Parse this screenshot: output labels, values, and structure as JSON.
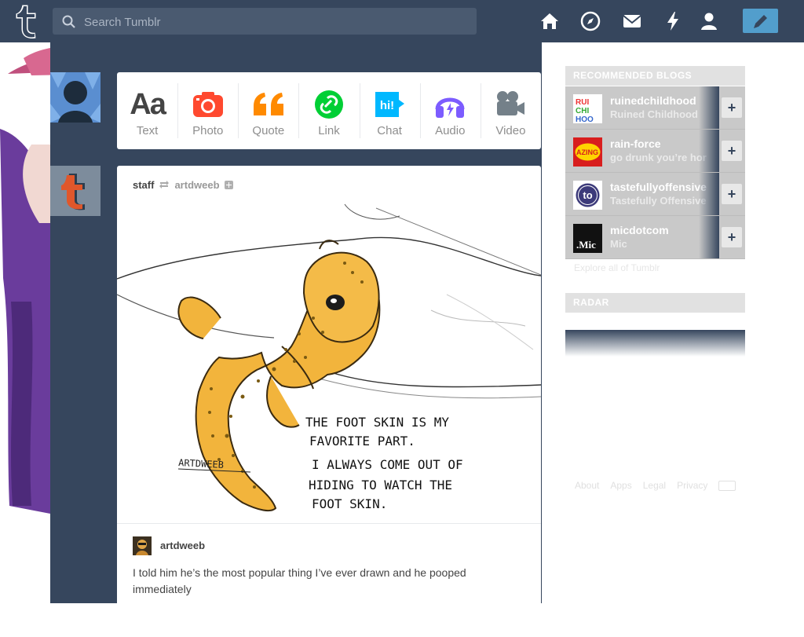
{
  "header": {
    "search_placeholder": "Search Tumblr",
    "nav_icons": [
      "home-icon",
      "compass-icon",
      "mail-icon",
      "lightning-icon",
      "account-icon"
    ],
    "compose_icon": "pencil-icon",
    "colors": {
      "bar": "#36465d",
      "compose": "#529ecc"
    }
  },
  "post_types": [
    {
      "label": "Text",
      "icon": "text-icon",
      "color": "#444444"
    },
    {
      "label": "Photo",
      "icon": "camera-icon",
      "color": "#ff492f"
    },
    {
      "label": "Quote",
      "icon": "quote-icon",
      "color": "#ff8a00"
    },
    {
      "label": "Link",
      "icon": "link-icon",
      "color": "#00cf35"
    },
    {
      "label": "Chat",
      "icon": "chat-icon",
      "color": "#00b8ff"
    },
    {
      "label": "Audio",
      "icon": "headphones-icon",
      "color": "#7c5cff"
    },
    {
      "label": "Video",
      "icon": "video-camera-icon",
      "color": "#748089"
    }
  ],
  "post": {
    "user": "staff",
    "reblogged_from": "artdweeb",
    "artwork_text": {
      "signature": "ARTDWEEB",
      "caption_lines": [
        "THE FOOT SKIN IS MY",
        "FAVORITE PART.",
        "I ALWAYS COME OUT OF",
        "HIDING TO WATCH THE",
        "FOOT SKIN."
      ]
    },
    "reblog": {
      "name": "artdweeb",
      "body": "I told him he’s the most popular thing I’ve ever drawn and he pooped immediately"
    }
  },
  "sidebar": {
    "recommended_title": "RECOMMENDED BLOGS",
    "blogs": [
      {
        "name": "ruinedchildhood",
        "title": "Ruined Childhood"
      },
      {
        "name": "rain-force",
        "title": "go drunk you’re hor"
      },
      {
        "name": "tastefullyoffensive",
        "title": "Tastefully Offensive"
      },
      {
        "name": "micdotcom",
        "title": "Mic"
      }
    ],
    "explore": "Explore all of Tumblr",
    "radar_title": "RADAR",
    "footer": [
      "About",
      "Apps",
      "Legal",
      "Privacy"
    ]
  }
}
